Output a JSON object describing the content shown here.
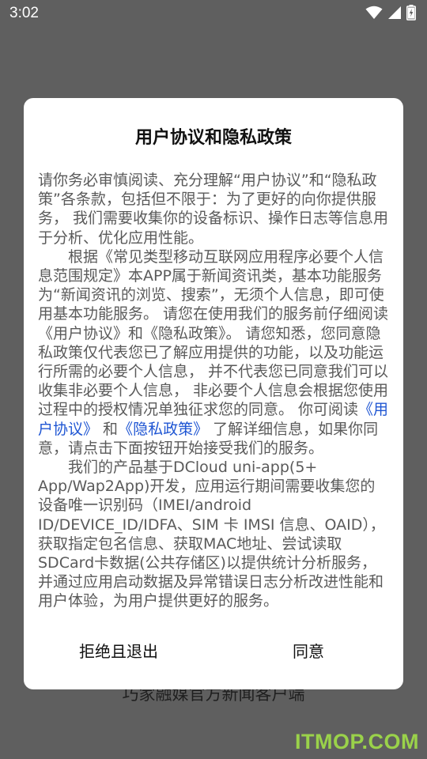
{
  "status_bar": {
    "time": "3:02",
    "icons": [
      "wifi-icon",
      "signal-icon",
      "battery-charging-icon"
    ]
  },
  "background": {
    "caption": "巧家融媒官方新闻客户端",
    "watermark": "ITMOP.COM"
  },
  "dialog": {
    "title": "用户协议和隐私政策",
    "p1": "请你务必审慎阅读、充分理解“用户协议”和“隐私政策”各条款，包括但不限于：为了更好的向你提供服务， 我们需要收集你的设备标识、操作日志等信息用于分析、优化应用性能。",
    "p2_before": "根据《常见类型移动互联网应用程序必要个人信息范围规定》本APP属于新闻资讯类，基本功能服务为“新闻资讯的浏览、搜索”，无须个人信息，即可使用基本功能服务。 请您在使用我们的服务前仔细阅读《用户协议》和《隐私政策》。 请您知悉，您同意隐私政策仅代表您已了解应用提供的功能，以及功能运行所需的必要个人信息， 并不代表您已同意我们可以收集非必要个人信息， 非必要个人信息会根据您使用过程中的授权情况单独征求您的同意。 你可阅读",
    "link_user_agreement": "《用户协议》",
    "p2_and": " 和",
    "link_privacy_policy": "《隐私政策》",
    "p2_after": " 了解详细信息，如果你同意，请点击下面按钮开始接受我们的服务。",
    "p3": "我们的产品基于DCloud uni-app(5+ App/Wap2App)开发，应用运行期间需要收集您的设备唯一识别码（IMEI/android ID/DEVICE_ID/IDFA、SIM 卡 IMSI 信息、OAID），获取指定包名信息、获取MAC地址、尝试读取SDCard卡数据(公共存储区)以提供统计分析服务，并通过应用启动数据及异常错误日志分析改进性能和用户体验，为用户提供更好的服务。",
    "reject_label": "拒绝且退出",
    "agree_label": "同意"
  },
  "colors": {
    "overlay": "#5f5f5f",
    "link": "#1f56d3",
    "body_text": "#5a5a5a",
    "watermark": "#9ad24a"
  }
}
